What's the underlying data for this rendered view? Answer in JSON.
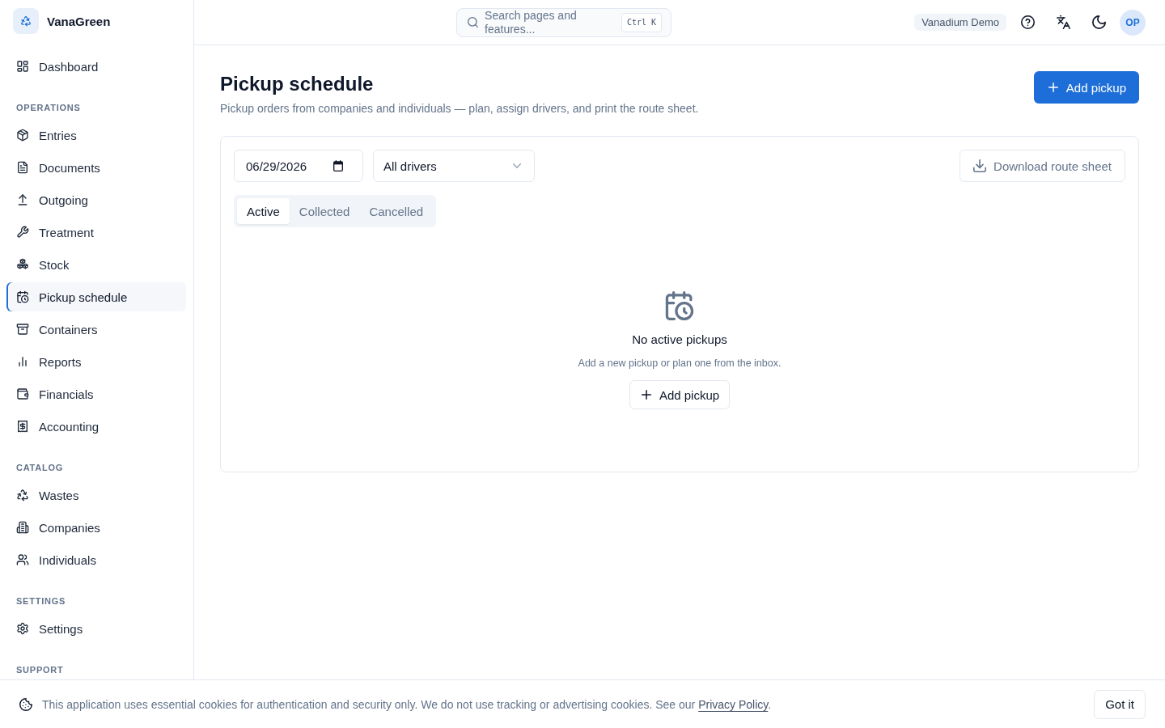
{
  "brand": {
    "name": "VanaGreen"
  },
  "sidebar": {
    "groups": [
      {
        "items": [
          {
            "label": "Dashboard",
            "selected": false
          }
        ]
      },
      {
        "heading": "OPERATIONS",
        "items": [
          {
            "label": "Entries",
            "selected": false
          },
          {
            "label": "Documents",
            "selected": false
          },
          {
            "label": "Outgoing",
            "selected": false
          },
          {
            "label": "Treatment",
            "selected": false
          },
          {
            "label": "Stock",
            "selected": false
          },
          {
            "label": "Pickup schedule",
            "selected": true
          },
          {
            "label": "Containers",
            "selected": false
          },
          {
            "label": "Reports",
            "selected": false
          },
          {
            "label": "Financials",
            "selected": false
          },
          {
            "label": "Accounting",
            "selected": false
          }
        ]
      },
      {
        "heading": "CATALOG",
        "items": [
          {
            "label": "Wastes",
            "selected": false
          },
          {
            "label": "Companies",
            "selected": false
          },
          {
            "label": "Individuals",
            "selected": false
          }
        ]
      },
      {
        "heading": "SETTINGS",
        "items": [
          {
            "label": "Settings",
            "selected": false
          }
        ]
      },
      {
        "heading": "SUPPORT"
      }
    ]
  },
  "header": {
    "search": {
      "placeholder": "Search pages and features...",
      "shortcut": "Ctrl K"
    },
    "workspace_badge": "Vanadium Demo",
    "avatar_initials": "OP"
  },
  "page": {
    "title": "Pickup schedule",
    "subtitle": "Pickup orders from companies and individuals — plan, assign drivers, and print the route sheet.",
    "primary_button": "Add pickup"
  },
  "panel": {
    "date_field": {
      "value": "06/29/2026"
    },
    "driver_select": {
      "value": "All drivers"
    },
    "download_button": {
      "label": "Download route sheet",
      "disabled": true
    },
    "tabs": [
      {
        "label": "Active",
        "selected": true
      },
      {
        "label": "Collected",
        "selected": false
      },
      {
        "label": "Cancelled",
        "selected": false
      }
    ],
    "empty_state": {
      "title": "No active pickups",
      "message": "Add a new pickup or plan one from the inbox.",
      "button": "Add pickup"
    }
  },
  "cookie_banner": {
    "text": "This application uses essential cookies for authentication and security only. We do not use tracking or advertising cookies. See our",
    "link": "Privacy Policy",
    "text_after": ".",
    "button": "Got it"
  }
}
